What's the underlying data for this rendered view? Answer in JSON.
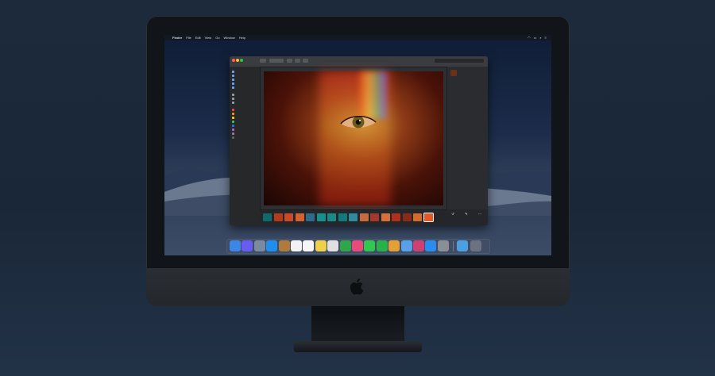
{
  "menubar": {
    "app_name": "Finder",
    "items": [
      "File",
      "Edit",
      "View",
      "Go",
      "Window",
      "Help"
    ],
    "icons": [
      "wifi-icon",
      "battery-icon",
      "search-icon",
      "control-center-icon"
    ]
  },
  "window": {
    "title": "",
    "search_placeholder": ""
  },
  "sidebar": {
    "favorites_header": "",
    "favorites": [
      "",
      "",
      "",
      "",
      ""
    ],
    "locations_header": "",
    "locations": [
      "",
      "",
      ""
    ],
    "tags_header": "",
    "tags": [
      {
        "label": "",
        "color": "#ff453a"
      },
      {
        "label": "",
        "color": "#ff9f0a"
      },
      {
        "label": "",
        "color": "#ffd60a"
      },
      {
        "label": "",
        "color": "#30d158"
      },
      {
        "label": "",
        "color": "#0a84ff"
      },
      {
        "label": "",
        "color": "#bf5af2"
      },
      {
        "label": "",
        "color": "#8e8e93"
      },
      {
        "label": "",
        "color": "#636366"
      }
    ]
  },
  "info": {
    "filename": "",
    "subtitle": "",
    "rows": [
      {
        "k": "",
        "v": ""
      },
      {
        "k": "",
        "v": ""
      },
      {
        "k": "",
        "v": ""
      },
      {
        "k": "",
        "v": ""
      },
      {
        "k": "",
        "v": ""
      },
      {
        "k": "",
        "v": ""
      },
      {
        "k": "",
        "v": ""
      },
      {
        "k": "",
        "v": ""
      },
      {
        "k": "",
        "v": ""
      },
      {
        "k": "",
        "v": ""
      },
      {
        "k": "",
        "v": ""
      },
      {
        "k": "",
        "v": ""
      },
      {
        "k": "",
        "v": ""
      },
      {
        "k": "",
        "v": ""
      },
      {
        "k": "",
        "v": ""
      },
      {
        "k": "",
        "v": ""
      },
      {
        "k": "",
        "v": ""
      },
      {
        "k": "",
        "v": ""
      },
      {
        "k": "",
        "v": ""
      },
      {
        "k": "",
        "v": ""
      },
      {
        "k": "",
        "v": ""
      },
      {
        "k": "",
        "v": ""
      }
    ]
  },
  "filmstrip_colors": [
    "#0d6b6b",
    "#b33a1a",
    "#c84a2a",
    "#d66030",
    "#2d6b8a",
    "#15908a",
    "#1a8a88",
    "#117a7a",
    "#2f8aa0",
    "#c66a40",
    "#a4382a",
    "#d6703a",
    "#b03020",
    "#8a2a18",
    "#d46a2c",
    "#e2582a"
  ],
  "actions": [
    {
      "icon": "rotate-icon",
      "label": ""
    },
    {
      "icon": "markup-icon",
      "label": ""
    },
    {
      "icon": "more-icon",
      "label": ""
    }
  ],
  "dock_colors": [
    "#3b86e6",
    "#6a5cf0",
    "#7a8aa0",
    "#1e8ef0",
    "#b07b3a",
    "#f2f2f2",
    "#f6f6f6",
    "#f0d04a",
    "#e0e0e0",
    "#2fa64a",
    "#ea4a7a",
    "#32c850",
    "#28b04a",
    "#e4a032",
    "#5aa0e8",
    "#d04070",
    "#2a8cf0",
    "#8a8e95",
    "#4aa0e0",
    "#6c7380"
  ],
  "dock_icons": [
    "finder-icon",
    "siri-icon",
    "launchpad-icon",
    "safari-icon",
    "mail-icon",
    "calendar-icon",
    "notes-icon",
    "reminders-icon",
    "maps-icon",
    "photos-icon",
    "facetime-icon",
    "messages-icon",
    "numbers-icon",
    "keynote-icon",
    "pages-icon",
    "music-icon",
    "app-store-icon",
    "system-preferences-icon",
    "downloads-folder-icon",
    "trash-icon"
  ]
}
